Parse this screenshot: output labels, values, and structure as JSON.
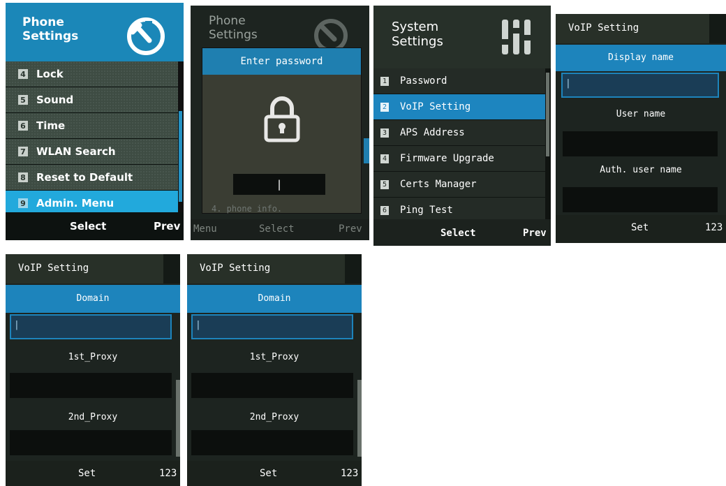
{
  "colors": {
    "accent": "#1d84bc",
    "highlight": "#22a9dc",
    "panel": "#3e4c43",
    "bg": "#1d2420"
  },
  "screen1": {
    "title_line1": "Phone",
    "title_line2": "Settings",
    "header_icon": "wrench-icon",
    "items": [
      {
        "num": "4",
        "label": "Lock"
      },
      {
        "num": "5",
        "label": "Sound"
      },
      {
        "num": "6",
        "label": "Time"
      },
      {
        "num": "7",
        "label": "WLAN Search"
      },
      {
        "num": "8",
        "label": "Reset to Default"
      },
      {
        "num": "9",
        "label": "Admin. Menu"
      }
    ],
    "soft_center": "Select",
    "soft_right": "Prev"
  },
  "screen2": {
    "bg_title_line1": "Phone",
    "bg_title_line2": "Settings",
    "dialog_title": "Enter password",
    "dialog_icon": "lock-icon",
    "password_value": "|",
    "bg_row_text": "4. phone info.",
    "soft_left": "Menu",
    "soft_center": "Select",
    "soft_right": "Prev"
  },
  "screen3": {
    "title_line1": "System",
    "title_line2": "Settings",
    "header_icon": "sliders-icon",
    "items": [
      {
        "num": "1",
        "label": "Password"
      },
      {
        "num": "2",
        "label": "VoIP Setting"
      },
      {
        "num": "3",
        "label": "APS Address"
      },
      {
        "num": "4",
        "label": "Firmware Upgrade"
      },
      {
        "num": "5",
        "label": "Certs Manager"
      },
      {
        "num": "6",
        "label": "Ping Test"
      }
    ],
    "soft_center": "Select",
    "soft_right": "Prev"
  },
  "screen4": {
    "title": "VoIP Setting",
    "fields": [
      {
        "label": "Display name",
        "value": "|"
      },
      {
        "label": "User name",
        "value": ""
      },
      {
        "label": "Auth. user name",
        "value": ""
      }
    ],
    "soft_center": "Set",
    "soft_right": "123"
  },
  "screen5": {
    "title": "VoIP Setting",
    "fields": [
      {
        "label": "Domain",
        "value": "|"
      },
      {
        "label": "1st_Proxy",
        "value": ""
      },
      {
        "label": "2nd_Proxy",
        "value": ""
      }
    ],
    "soft_center": "Set",
    "soft_right": "123"
  },
  "screen6": {
    "title": "VoIP Setting",
    "fields": [
      {
        "label": "Domain",
        "value": "|"
      },
      {
        "label": "1st_Proxy",
        "value": ""
      },
      {
        "label": "2nd_Proxy",
        "value": ""
      }
    ],
    "soft_center": "Set",
    "soft_right": "123"
  }
}
